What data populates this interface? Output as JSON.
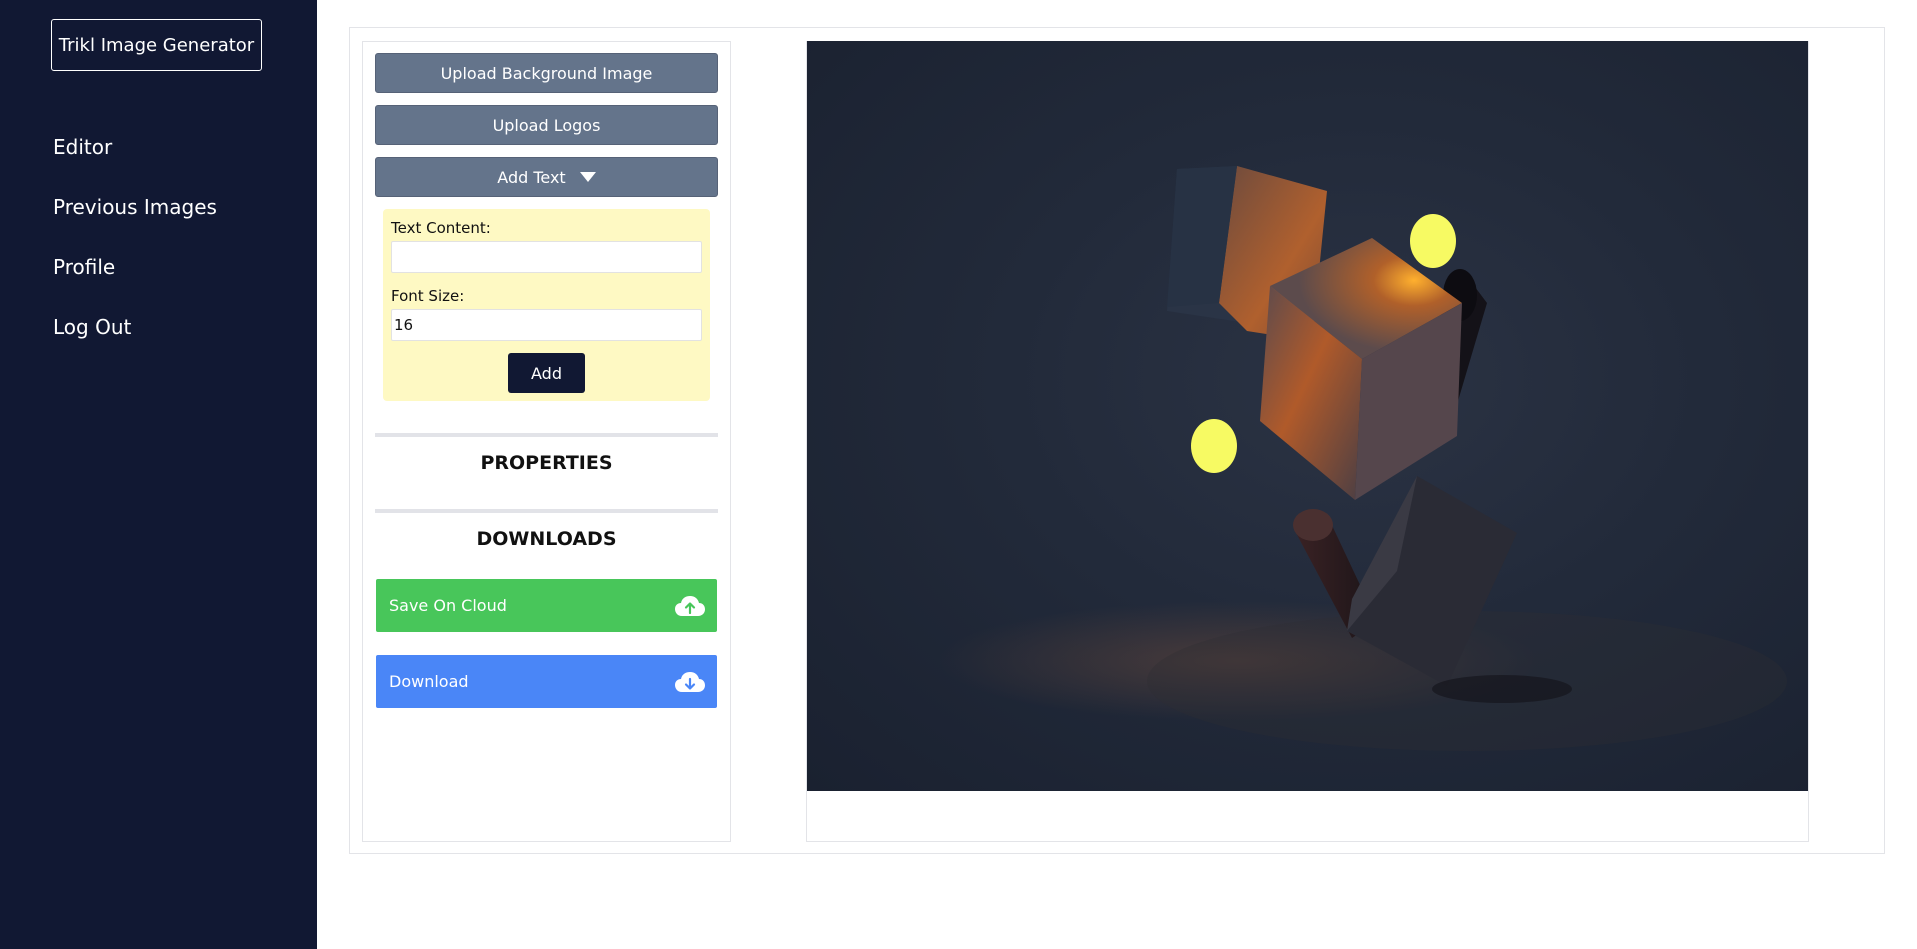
{
  "sidebar": {
    "brand": "Trikl Image Generator",
    "nav": [
      {
        "label": "Editor"
      },
      {
        "label": "Previous Images"
      },
      {
        "label": "Profile"
      },
      {
        "label": "Log Out"
      }
    ]
  },
  "panel": {
    "upload_background_label": "Upload Background Image",
    "upload_logos_label": "Upload Logos",
    "add_text_label": "Add Text",
    "text_form": {
      "text_content_label": "Text Content:",
      "text_content_value": "",
      "font_size_label": "Font Size:",
      "font_size_value": "16",
      "add_button_label": "Add"
    },
    "properties_heading": "PROPERTIES",
    "downloads_heading": "DOWNLOADS",
    "save_cloud_label": "Save On Cloud",
    "download_label": "Download"
  },
  "colors": {
    "sidebar_bg": "#111833",
    "gray_button": "#64748b",
    "text_form_bg": "#fef9c3",
    "save_cloud": "#48c65a",
    "download": "#4a86f7",
    "yellow_dot": "#f7fa63"
  },
  "icons": {
    "dropdown": "caret-down-icon",
    "save_cloud": "cloud-upload-icon",
    "download": "cloud-download-icon"
  }
}
